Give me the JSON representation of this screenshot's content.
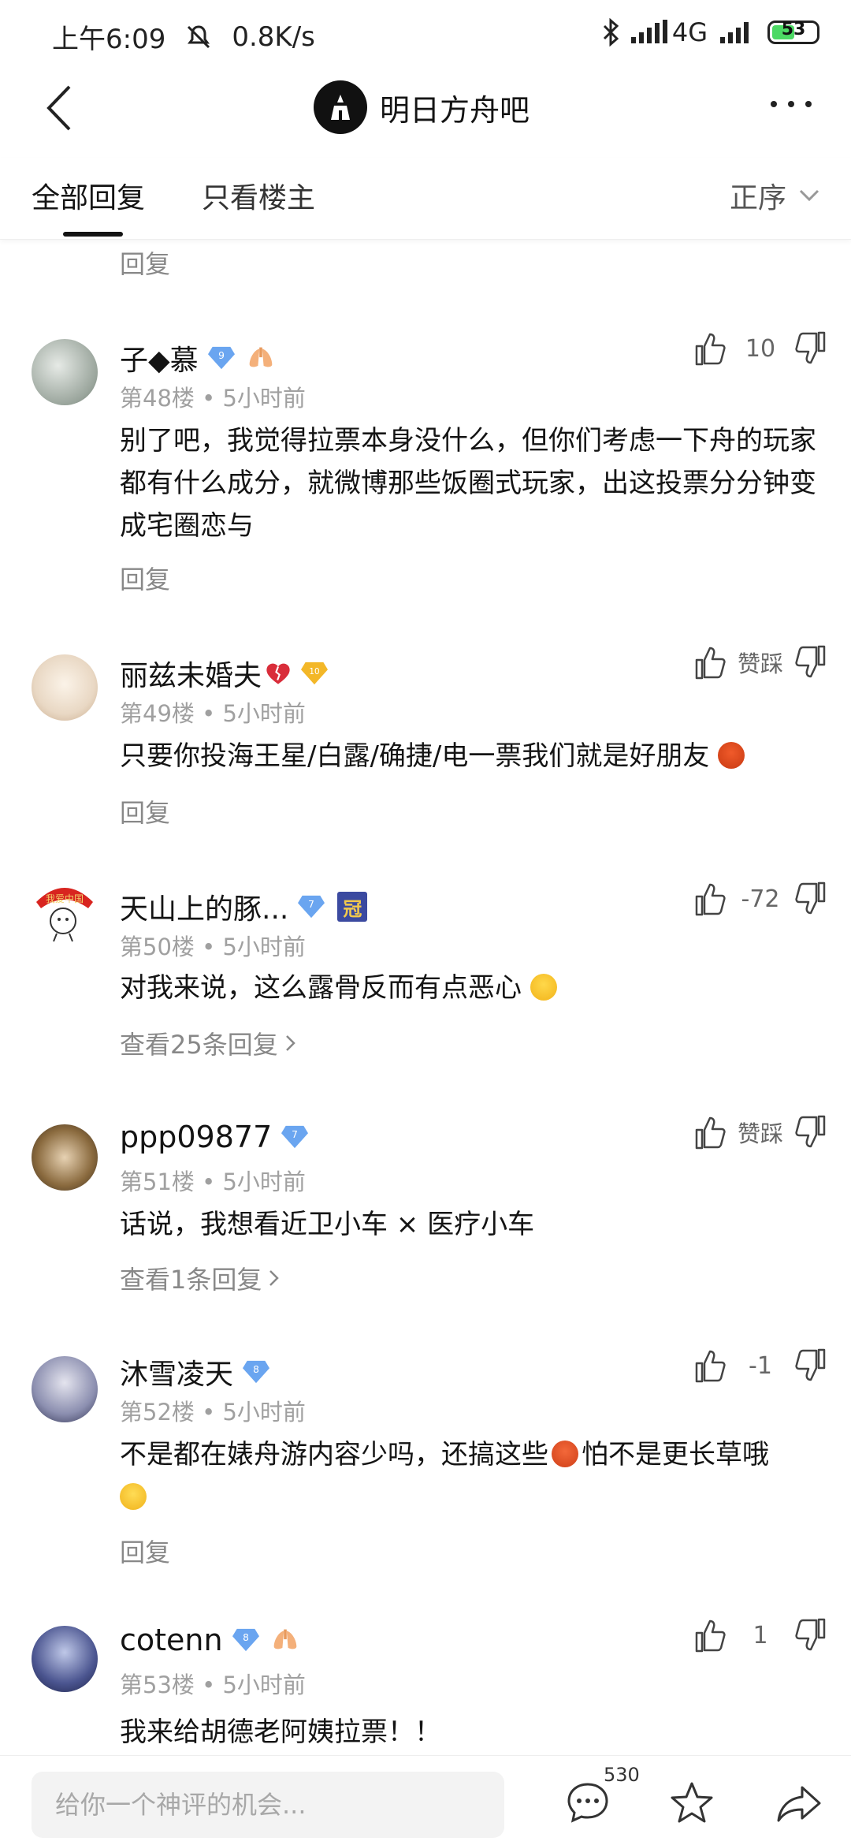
{
  "status": {
    "time": "上午6:09",
    "speed": "0.8K/s",
    "network": "4G",
    "battery": "53"
  },
  "header": {
    "forum_name": "明日方舟吧"
  },
  "tabs": {
    "all": "全部回复",
    "owner_only": "只看楼主",
    "sort": "正序"
  },
  "top_reply": "回复",
  "comments": [
    {
      "user": "子◆慕",
      "level": "9",
      "floor": "第48楼",
      "time": "5小时前",
      "votes": "10",
      "text": "别了吧，我觉得拉票本身没什么，但你们考虑一下舟的玩家都有什么成分，就微博那些饭圈式玩家，出这投票分分钟变成宅圈恋与",
      "reply": "回复"
    },
    {
      "user": "丽兹未婚夫",
      "level": "10",
      "floor": "第49楼",
      "time": "5小时前",
      "votes": "赞踩",
      "text": "只要你投海王星/白露/确捷/电一票我们就是好朋友",
      "reply": "回复"
    },
    {
      "user": "天山上的豚...",
      "level": "7",
      "floor": "第50楼",
      "time": "5小时前",
      "votes": "-72",
      "text": "对我来说，这么露骨反而有点恶心",
      "reply": "查看25条回复"
    },
    {
      "user": "ppp09877",
      "level": "7",
      "floor": "第51楼",
      "time": "5小时前",
      "votes": "赞踩",
      "text": "话说，我想看近卫小车 × 医疗小车",
      "reply": "查看1条回复"
    },
    {
      "user": "沐雪凌天",
      "level": "8",
      "floor": "第52楼",
      "time": "5小时前",
      "votes": "-1",
      "text": "不是都在婊舟游内容少吗，还搞这些",
      "text2": "怕不是更长草哦",
      "reply": "回复"
    },
    {
      "user": "cotenn",
      "level": "8",
      "floor": "第53楼",
      "time": "5小时前",
      "votes": "1",
      "text": "我来给胡德老阿姨拉票！！"
    }
  ],
  "crown_badge": "冠",
  "bottom": {
    "placeholder": "给你一个神评的机会...",
    "comment_count": "530"
  },
  "colors": {
    "level_badge": "#6aa5f0",
    "gold_badge": "#f3b728",
    "meta_gray": "#a0a0a0"
  }
}
